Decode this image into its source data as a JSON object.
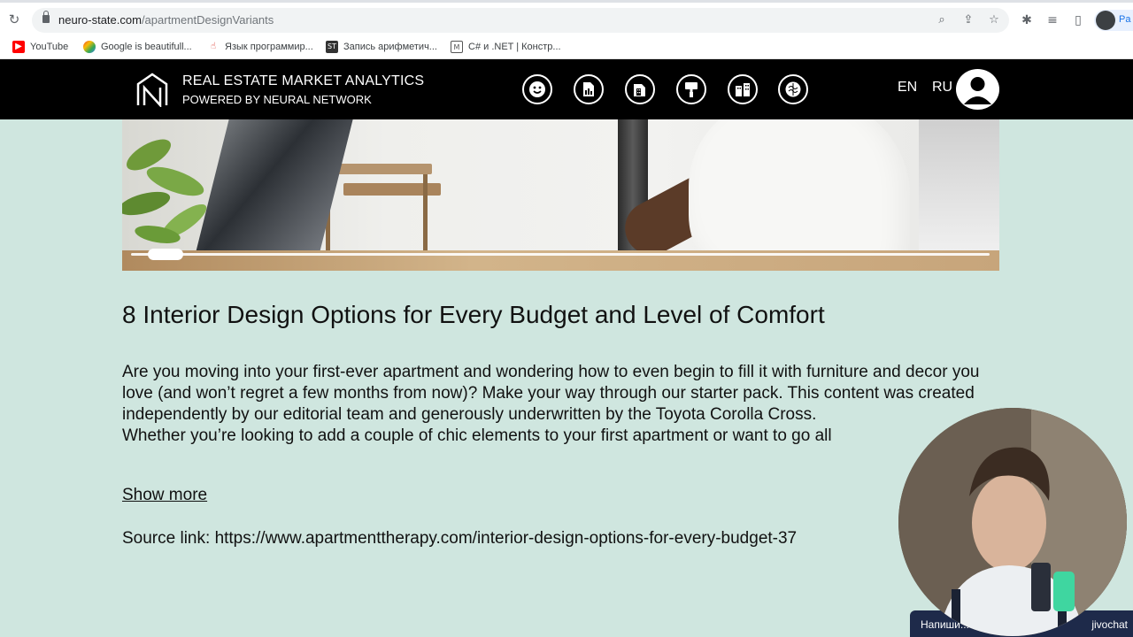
{
  "browser": {
    "url_host": "neuro-state.com",
    "url_path": "/apartmentDesignVariants",
    "profile_label": "Pa",
    "bookmarks": [
      {
        "label": "YouTube",
        "icon": "youtube-icon",
        "color": "#ff0000"
      },
      {
        "label": "Google is beautifull...",
        "icon": "google-icon",
        "color": "#fbbc04"
      },
      {
        "label": "Язык программир...",
        "icon": "hand-cursor-icon",
        "color": "#d93025"
      },
      {
        "label": "Запись арифметич...",
        "icon": "st-icon",
        "color": "#333333"
      },
      {
        "label": "C# и .NET | Констр...",
        "icon": "mail-icon",
        "color": "#555555"
      }
    ]
  },
  "header": {
    "title": "REAL ESTATE MARKET ANALYTICS",
    "subtitle": "POWERED BY NEURAL NETWORK",
    "nav_icons": [
      "smiley-icon",
      "document-chart-icon",
      "building-doc-icon",
      "paint-roller-icon",
      "city-icon",
      "brain-icon"
    ],
    "lang_en": "EN",
    "lang_ru": "RU",
    "background": "#000000"
  },
  "article": {
    "title": "8 Interior Design Options for Every Budget and Level of Comfort",
    "paragraph_1": "Are you moving into your first-ever apartment and wondering how to even begin to fill it with furniture and decor you love (and won’t regret a few months from now)? Make your way through our starter pack. This content was created independently by our editorial team and generously underwritten by the Toyota Corolla Cross.",
    "paragraph_2": "Whether you’re looking to add a couple of chic elements to your first apartment or want to go all",
    "show_more": "Show more",
    "source_label": "Source link:",
    "source_url": "https://www.apartmenttherapy.com/interior-design-options-for-every-budget-37"
  },
  "slider": {
    "position": 0.02
  },
  "overlay": {
    "chat_left": "Напиши...",
    "chat_right": "jivochat"
  },
  "colors": {
    "page_bg": "#cfe6df",
    "text": "#111111"
  }
}
